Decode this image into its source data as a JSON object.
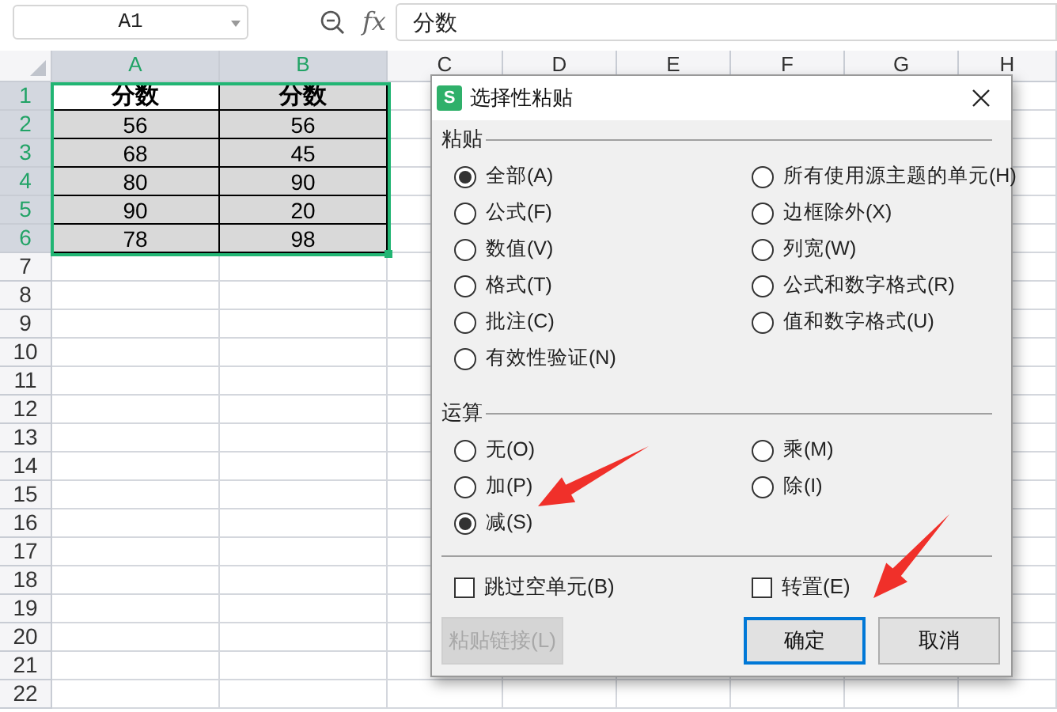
{
  "formula_bar": {
    "cell_ref": "A1",
    "fx": "fx",
    "formula": "分数"
  },
  "columns": [
    {
      "label": "A",
      "selected": true
    },
    {
      "label": "B",
      "selected": true
    },
    {
      "label": "C",
      "selected": false
    },
    {
      "label": "D",
      "selected": false
    },
    {
      "label": "E",
      "selected": false
    },
    {
      "label": "F",
      "selected": false
    },
    {
      "label": "G",
      "selected": false
    },
    {
      "label": "H",
      "selected": false
    }
  ],
  "rows": [
    {
      "number": "1",
      "selected": true,
      "kind": "header",
      "cells": [
        {
          "text": "分数",
          "active": true
        },
        {
          "text": "分数",
          "active": false
        }
      ]
    },
    {
      "number": "2",
      "selected": true,
      "kind": "data",
      "cells": [
        {
          "text": "56",
          "active": false
        },
        {
          "text": "56",
          "active": false
        }
      ]
    },
    {
      "number": "3",
      "selected": true,
      "kind": "data",
      "cells": [
        {
          "text": "68",
          "active": false
        },
        {
          "text": "45",
          "active": false
        }
      ]
    },
    {
      "number": "4",
      "selected": true,
      "kind": "data",
      "cells": [
        {
          "text": "80",
          "active": false
        },
        {
          "text": "90",
          "active": false
        }
      ]
    },
    {
      "number": "5",
      "selected": true,
      "kind": "data",
      "cells": [
        {
          "text": "90",
          "active": false
        },
        {
          "text": "20",
          "active": false
        }
      ]
    },
    {
      "number": "6",
      "selected": true,
      "kind": "data",
      "cells": [
        {
          "text": "78",
          "active": false
        },
        {
          "text": "98",
          "active": false
        }
      ]
    },
    {
      "number": "7",
      "selected": false
    },
    {
      "number": "8",
      "selected": false
    },
    {
      "number": "9",
      "selected": false
    },
    {
      "number": "10",
      "selected": false
    },
    {
      "number": "11",
      "selected": false
    },
    {
      "number": "12",
      "selected": false
    },
    {
      "number": "13",
      "selected": false
    },
    {
      "number": "14",
      "selected": false
    },
    {
      "number": "15",
      "selected": false
    },
    {
      "number": "16",
      "selected": false
    },
    {
      "number": "17",
      "selected": false
    },
    {
      "number": "18",
      "selected": false
    },
    {
      "number": "19",
      "selected": false
    },
    {
      "number": "20",
      "selected": false
    },
    {
      "number": "21",
      "selected": false
    },
    {
      "number": "22",
      "selected": false
    }
  ],
  "dialog": {
    "icon_letter": "S",
    "title": "选择性粘贴",
    "paste": {
      "label": "粘贴",
      "options": [
        {
          "label": "全部(A)",
          "selected": true
        },
        {
          "label": "所有使用源主题的单元(H)",
          "selected": false
        },
        {
          "label": "公式(F)",
          "selected": false
        },
        {
          "label": "边框除外(X)",
          "selected": false
        },
        {
          "label": "数值(V)",
          "selected": false
        },
        {
          "label": "列宽(W)",
          "selected": false
        },
        {
          "label": "格式(T)",
          "selected": false
        },
        {
          "label": "公式和数字格式(R)",
          "selected": false
        },
        {
          "label": "批注(C)",
          "selected": false
        },
        {
          "label": "值和数字格式(U)",
          "selected": false
        },
        {
          "label": "有效性验证(N)",
          "selected": false
        }
      ]
    },
    "operation": {
      "label": "运算",
      "options": [
        {
          "label": "无(O)",
          "selected": false
        },
        {
          "label": "乘(M)",
          "selected": false
        },
        {
          "label": "加(P)",
          "selected": false
        },
        {
          "label": "除(I)",
          "selected": false
        },
        {
          "label": "减(S)",
          "selected": true
        }
      ]
    },
    "checkboxes": [
      {
        "label": "跳过空单元(B)",
        "checked": false
      },
      {
        "label": "转置(E)",
        "checked": false
      }
    ],
    "buttons": [
      {
        "label": "粘贴链接(L)",
        "disabled": true,
        "default": false
      },
      {
        "label": "确定",
        "disabled": false,
        "default": true
      },
      {
        "label": "取消",
        "disabled": false,
        "default": false
      }
    ]
  }
}
